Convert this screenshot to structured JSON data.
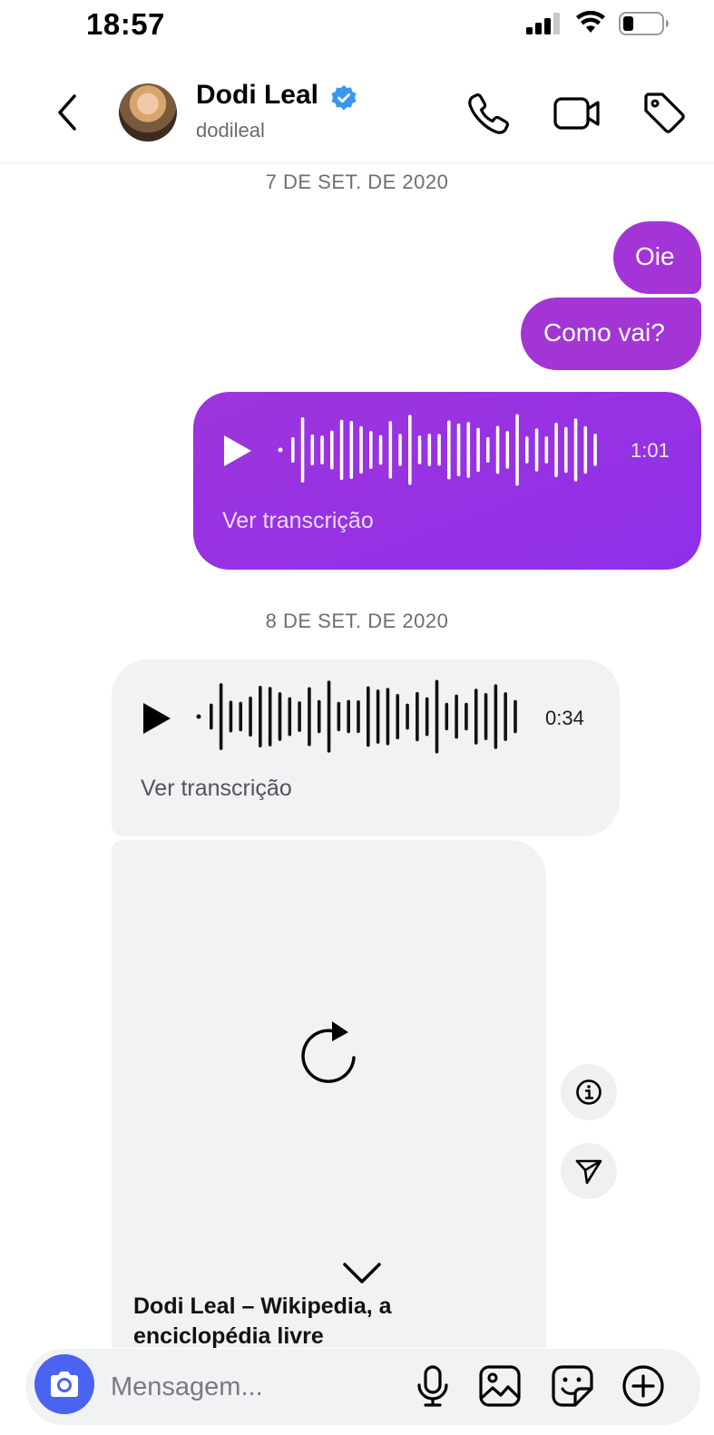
{
  "status_bar": {
    "time": "18:57"
  },
  "header": {
    "contact_name": "Dodi Leal",
    "handle": "dodileal"
  },
  "thread": {
    "date_1": "7 DE SET. DE 2020",
    "outgoing": [
      {
        "text": "Oie"
      },
      {
        "text": "Como vai?"
      }
    ],
    "voice_out": {
      "duration": "1:01",
      "transcript_label": "Ver transcrição"
    },
    "date_2": "8 DE SET. DE 2020",
    "voice_in": {
      "duration": "0:34",
      "transcript_label": "Ver transcrição"
    },
    "link_card": {
      "title": "Dodi Leal – Wikipedia, a enciclopédia livre"
    }
  },
  "composer": {
    "placeholder": "Mensagem..."
  },
  "colors": {
    "outgoing_bubble": "#a335d6",
    "incoming_bubble": "#f1f2f4",
    "camera_button": "#4a63f0",
    "verified_badge": "#3897f0"
  },
  "icons": [
    "back-icon",
    "verified-icon",
    "phone-icon",
    "video-icon",
    "tag-icon",
    "play-icon",
    "waveform",
    "reload-icon",
    "chevron-down-icon",
    "info-icon",
    "send-icon",
    "camera-icon",
    "mic-icon",
    "gallery-icon",
    "sticker-icon",
    "plus-icon"
  ]
}
